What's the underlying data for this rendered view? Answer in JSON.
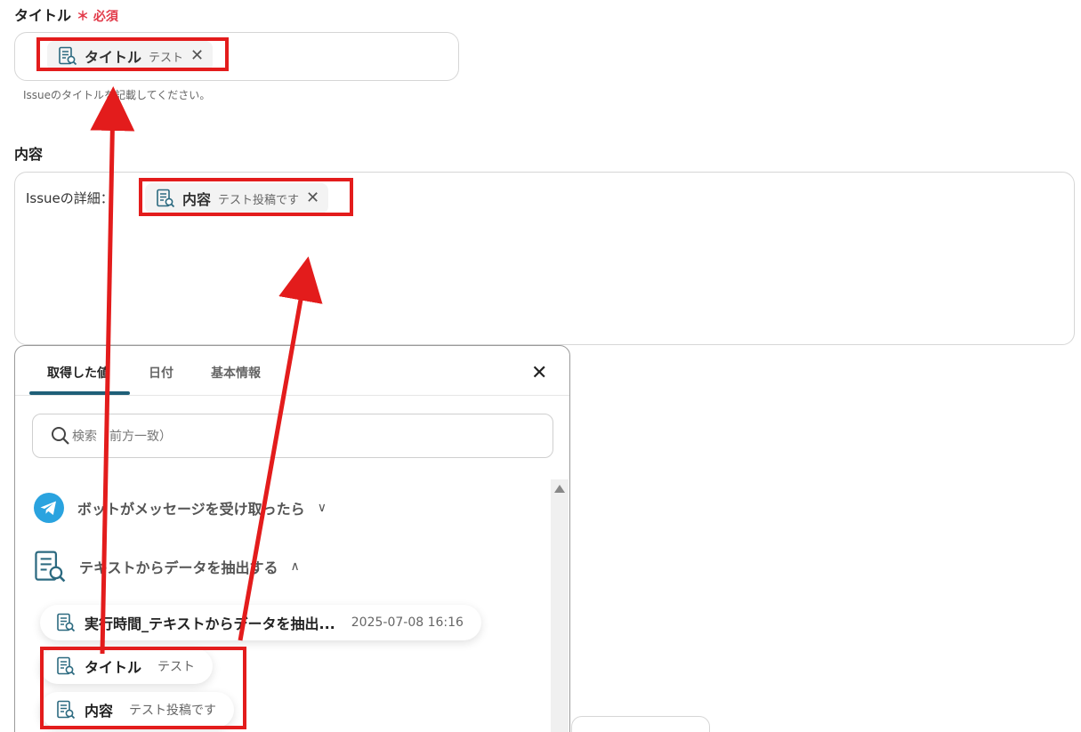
{
  "title_field": {
    "label": "タイトル",
    "required_mark": "＊ 必須",
    "chip_label": "タイトル",
    "chip_value": "テスト",
    "hint": "Issueのタイトルを記載してください。"
  },
  "content_field": {
    "label": "内容",
    "prefix": "Issueの詳細：",
    "chip_label": "内容",
    "chip_value": "テスト投稿です"
  },
  "panel": {
    "tabs": [
      "取得した値",
      "日付",
      "基本情報"
    ],
    "search_placeholder": "検索（前方一致）",
    "sections": [
      {
        "label": "ボットがメッセージを受け取ったら",
        "expanded": false,
        "icon": "telegram-icon"
      },
      {
        "label": "テキストからデータを抽出する",
        "expanded": true,
        "icon": "doc-search-icon"
      }
    ],
    "items": [
      {
        "label": "実行時間_テキストからデータを抽出...",
        "value": "2025-07-08 16:16"
      },
      {
        "label": "タイトル",
        "value": "テスト"
      },
      {
        "label": "内容",
        "value": "テスト投稿です"
      }
    ]
  },
  "colors": {
    "highlight": "#e31c1c",
    "tab_accent": "#1f5f78",
    "required": "#e23b4a",
    "telegram": "#2aa3df",
    "icon": "#2c6a80"
  }
}
